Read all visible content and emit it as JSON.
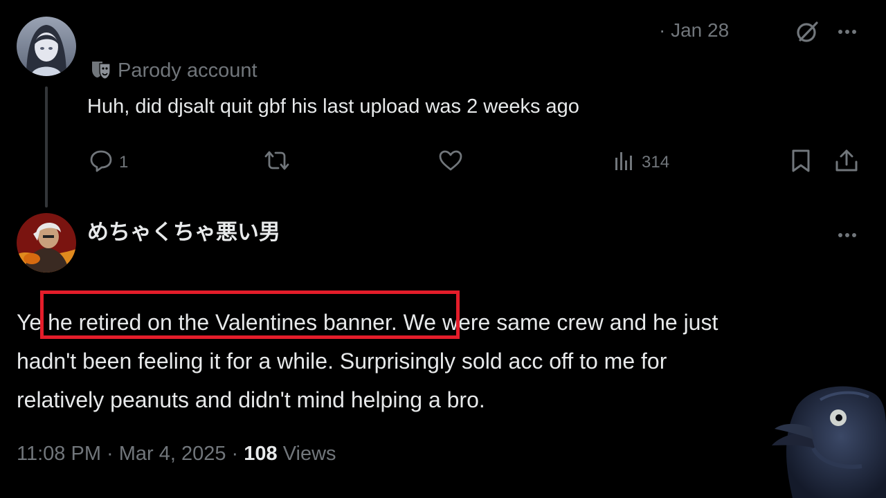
{
  "parent_tweet": {
    "date": "· Jan 28",
    "parody_label": "Parody account",
    "text": "Huh, did djsalt quit gbf his last upload was 2 weeks ago",
    "actions": {
      "reply_count": "1",
      "retweet_count": "",
      "like_count": "",
      "views_count": "314"
    }
  },
  "reply_tweet": {
    "display_name": "めちゃくちゃ悪い男",
    "text_lines": [
      "Ye he retired on the Valentines banner. We were same crew and he just",
      "hadn't been feeling it for a while. Surprisingly sold acc off to me for",
      "relatively peanuts and didn't mind helping a bro."
    ],
    "timestamp": "11:08 PM · Mar 4, 2025 · ",
    "views_count": "108",
    "views_label": " Views"
  },
  "colors": {
    "background": "#000000",
    "primary_text": "#e7e9ea",
    "secondary_text": "#71767b",
    "highlight_border": "#e41d2a",
    "thread_line": "#333639"
  },
  "icons": {
    "reply": "reply-icon",
    "retweet": "retweet-icon",
    "like": "heart-icon",
    "views": "views-icon",
    "bookmark": "bookmark-icon",
    "share": "share-icon",
    "grok": "grok-icon",
    "more": "more-icon",
    "parody": "theater-mask-icon"
  }
}
